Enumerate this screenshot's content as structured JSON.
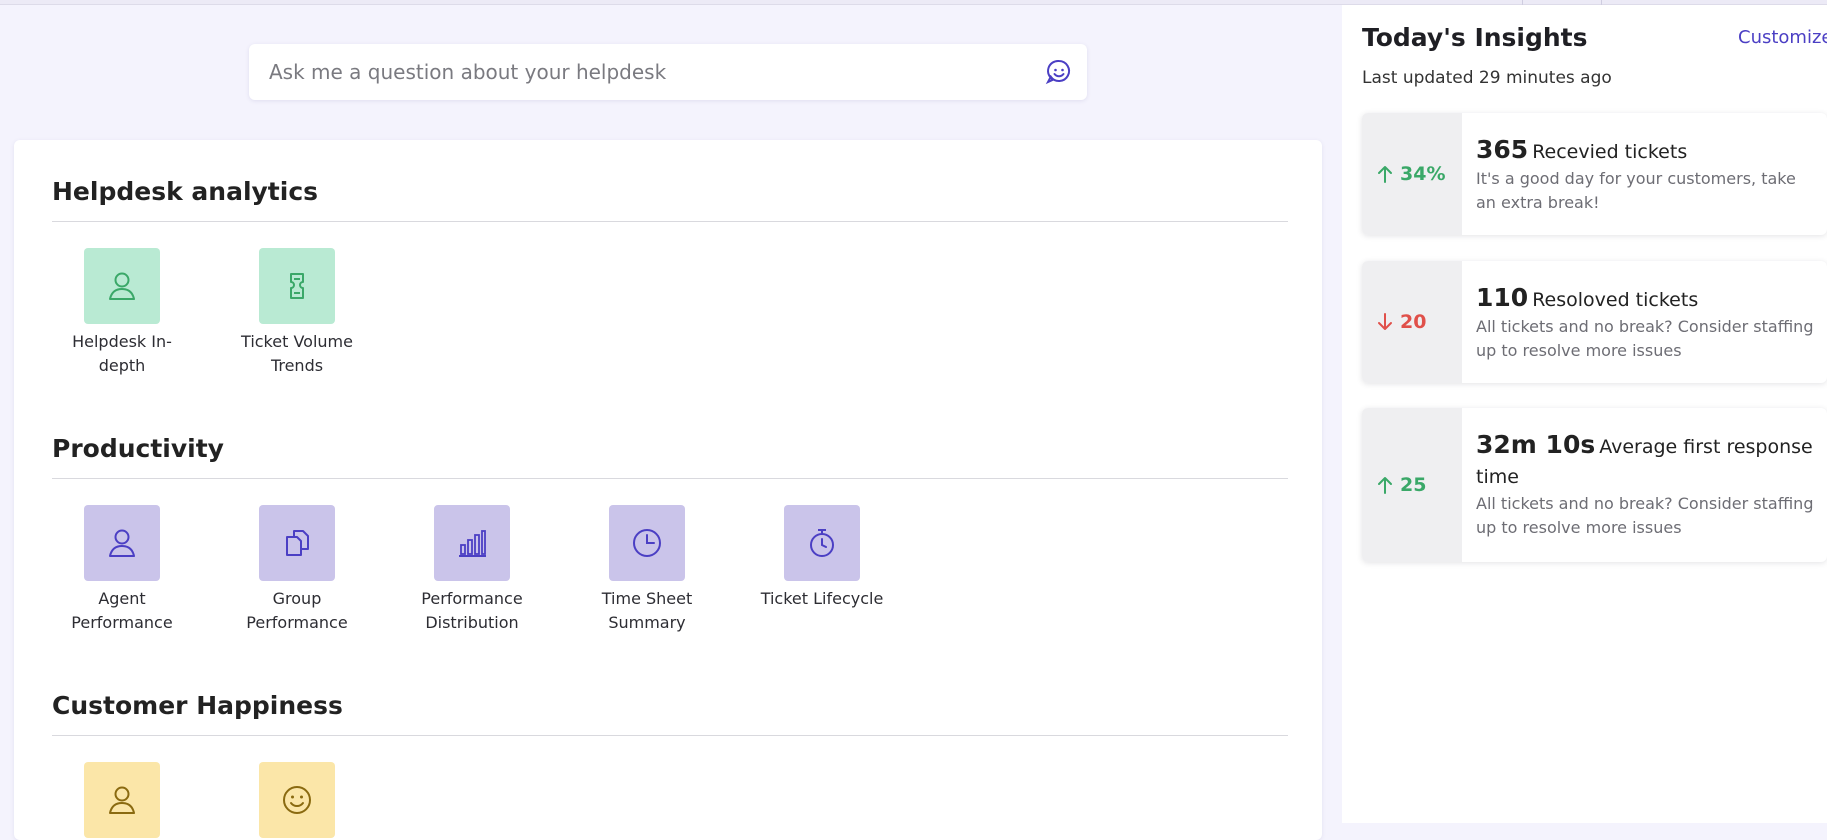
{
  "search": {
    "placeholder": "Ask me a question about your helpdesk"
  },
  "sections": [
    {
      "title": "Helpdesk analytics",
      "tiles": [
        {
          "label": "Helpdesk In-depth",
          "icon": "user-icon"
        },
        {
          "label": "Ticket Volume Trends",
          "icon": "ticket-icon"
        }
      ]
    },
    {
      "title": "Productivity",
      "tiles": [
        {
          "label": "Agent Performance",
          "icon": "user-icon"
        },
        {
          "label": "Group Performance",
          "icon": "documents-icon"
        },
        {
          "label": "Performance Distribution",
          "icon": "bar-chart-icon"
        },
        {
          "label": "Time Sheet Summary",
          "icon": "clock-icon"
        },
        {
          "label": "Ticket Lifecycle",
          "icon": "stopwatch-icon"
        }
      ]
    },
    {
      "title": "Customer Happiness",
      "tiles": [
        {
          "label": "",
          "icon": "user-icon"
        },
        {
          "label": "",
          "icon": "smiley-icon"
        }
      ]
    }
  ],
  "insights": {
    "title": "Today's Insights",
    "customize": "Customize",
    "updated": "Last updated 29 minutes ago",
    "items": [
      {
        "direction": "up",
        "delta": "34%",
        "value": "365",
        "label": "Recevied tickets",
        "desc": "It's a good day for your customers, take an extra break!"
      },
      {
        "direction": "down",
        "delta": "20",
        "value": "110",
        "label": "Resoloved tickets",
        "desc": "All tickets and no break? Consider staffing up to resolve more issues"
      },
      {
        "direction": "up",
        "delta": "25",
        "value": "32m 10s",
        "label": "Average first response time",
        "desc": "All tickets and no break? Consider staffing up to resolve more issues"
      }
    ]
  },
  "colors": {
    "accent": "#4b3fc4",
    "up": "#3aa868",
    "down": "#e0504a",
    "green_tile": "#b9ead3",
    "purple_tile": "#cac4ea",
    "yellow_tile": "#fbe6a8"
  }
}
